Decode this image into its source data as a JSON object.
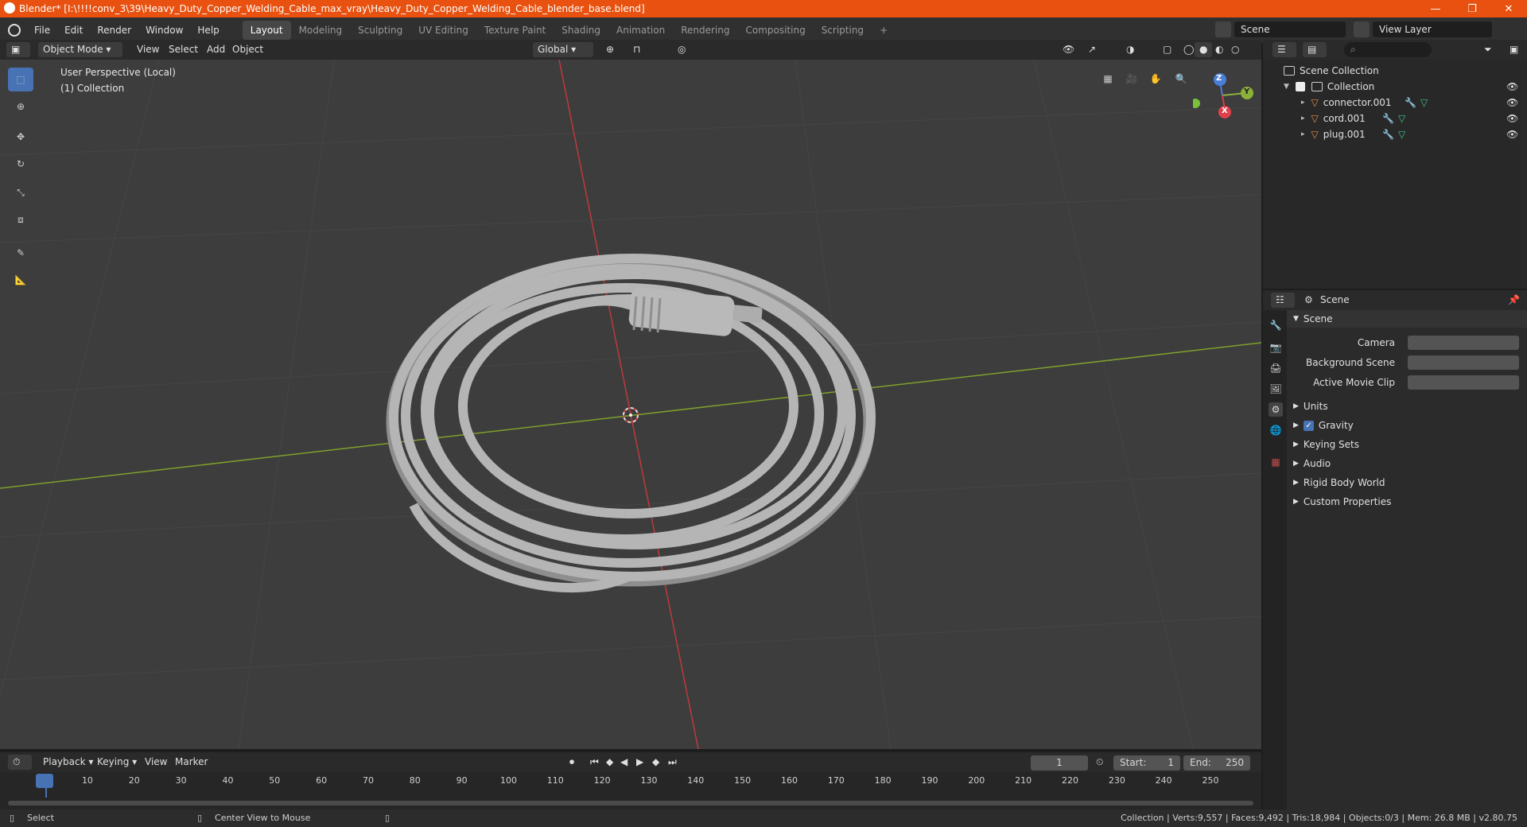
{
  "window": {
    "title": "Blender* [I:\\!!!!conv_3\\39\\Heavy_Duty_Copper_Welding_Cable_max_vray\\Heavy_Duty_Copper_Welding_Cable_blender_base.blend]",
    "controls": {
      "minimize": "—",
      "maximize": "❐",
      "close": "✕"
    }
  },
  "menu": {
    "items": [
      "File",
      "Edit",
      "Render",
      "Window",
      "Help"
    ],
    "workspaces": [
      "Layout",
      "Modeling",
      "Sculpting",
      "UV Editing",
      "Texture Paint",
      "Shading",
      "Animation",
      "Rendering",
      "Compositing",
      "Scripting"
    ],
    "active_workspace": "Layout",
    "add_tab": "+",
    "scene": "Scene",
    "view_layer": "View Layer"
  },
  "viewport_header": {
    "mode": "Object Mode",
    "menus": [
      "View",
      "Select",
      "Add",
      "Object"
    ],
    "orientation": "Global"
  },
  "viewport": {
    "perspective": "User Perspective (Local)",
    "collection": "(1) Collection",
    "gizmo": {
      "z": "Z",
      "y": "Y",
      "x": "X"
    },
    "tools": [
      "select-box-icon",
      "cursor-icon",
      "move-icon",
      "rotate-icon",
      "scale-icon",
      "transform-icon",
      "annotate-icon",
      "measure-icon"
    ],
    "colors": {
      "background": "#3d3d3d",
      "x_axis": "#c0393b",
      "y_axis": "#7ea02a",
      "cable": "#a8a8a8"
    }
  },
  "outliner": {
    "root": "Scene Collection",
    "collection": "Collection",
    "objects": [
      {
        "name": "connector.001"
      },
      {
        "name": "cord.001"
      },
      {
        "name": "plug.001"
      }
    ]
  },
  "properties": {
    "header": "Scene",
    "section": "Scene",
    "fields": [
      {
        "label": "Camera",
        "value": ""
      },
      {
        "label": "Background Scene",
        "value": ""
      },
      {
        "label": "Active Movie Clip",
        "value": ""
      }
    ],
    "panels": [
      {
        "label": "Units",
        "checkbox": false
      },
      {
        "label": "Gravity",
        "checkbox": true
      },
      {
        "label": "Keying Sets",
        "checkbox": false
      },
      {
        "label": "Audio",
        "checkbox": false
      },
      {
        "label": "Rigid Body World",
        "checkbox": false
      },
      {
        "label": "Custom Properties",
        "checkbox": false
      }
    ]
  },
  "timeline": {
    "menus": [
      "Playback",
      "Keying",
      "View",
      "Marker"
    ],
    "current_frame": "1",
    "start_label": "Start:",
    "start": "1",
    "end_label": "End:",
    "end": "250",
    "ticks": [
      "1",
      "10",
      "20",
      "30",
      "40",
      "50",
      "60",
      "70",
      "80",
      "90",
      "100",
      "110",
      "120",
      "130",
      "140",
      "150",
      "160",
      "170",
      "180",
      "190",
      "200",
      "210",
      "220",
      "230",
      "240",
      "250"
    ]
  },
  "statusbar": {
    "left": "Select",
    "middle": "Center View to Mouse",
    "right": "Collection | Verts:9,557 | Faces:9,492 | Tris:18,984 | Objects:0/3 | Mem: 26.8 MB | v2.80.75"
  }
}
